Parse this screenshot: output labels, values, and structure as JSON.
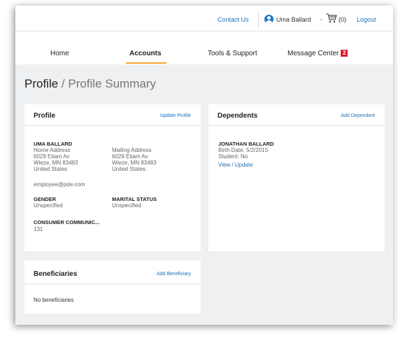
{
  "header": {
    "contact_label": "Contact Us",
    "user_name": "Uma Ballard",
    "cart_count": "(0)",
    "logout_label": "Logout"
  },
  "nav": {
    "home": "Home",
    "accounts": "Accounts",
    "tools": "Tools & Support",
    "messages": "Message Center",
    "message_badge": "2"
  },
  "page": {
    "title_main": "Profile",
    "title_sub": " / Profile Summary"
  },
  "profile": {
    "title": "Profile",
    "update_label": "Update Profile",
    "name": "UMA BALLARD",
    "home_address": {
      "label": "Home Address",
      "line1": "6029 Etiam Av",
      "line2": "Wieze, MN 83483",
      "line3": "United States"
    },
    "mailing_address": {
      "label": "Mailing Address",
      "line1": "6029 Etiam Av",
      "line2": "Wieze, MN 83483",
      "line3": "United States"
    },
    "email": "employee@pde.com",
    "gender_label": "GENDER",
    "gender_value": "Unspecified",
    "marital_label": "MARITAL STATUS",
    "marital_value": "Unspecified",
    "consumer_label": "CONSUMER COMMUNIC...",
    "consumer_value": "131"
  },
  "dependents": {
    "title": "Dependents",
    "add_label": "Add Dependent",
    "name": "JONATHAN BALLARD",
    "birth_date": "Birth Date: 5/2/2015",
    "student": "Student: No",
    "view_label": "View / Update"
  },
  "beneficiaries": {
    "title": "Beneficiaries",
    "add_label": "Add Beneficiary",
    "empty_text": "No beneficiaries"
  },
  "colors": {
    "link": "#1e6fb8",
    "active_underline": "#f0a830",
    "badge": "#d9202a",
    "avatar": "#1f78c8",
    "background": "#eef0f2"
  }
}
